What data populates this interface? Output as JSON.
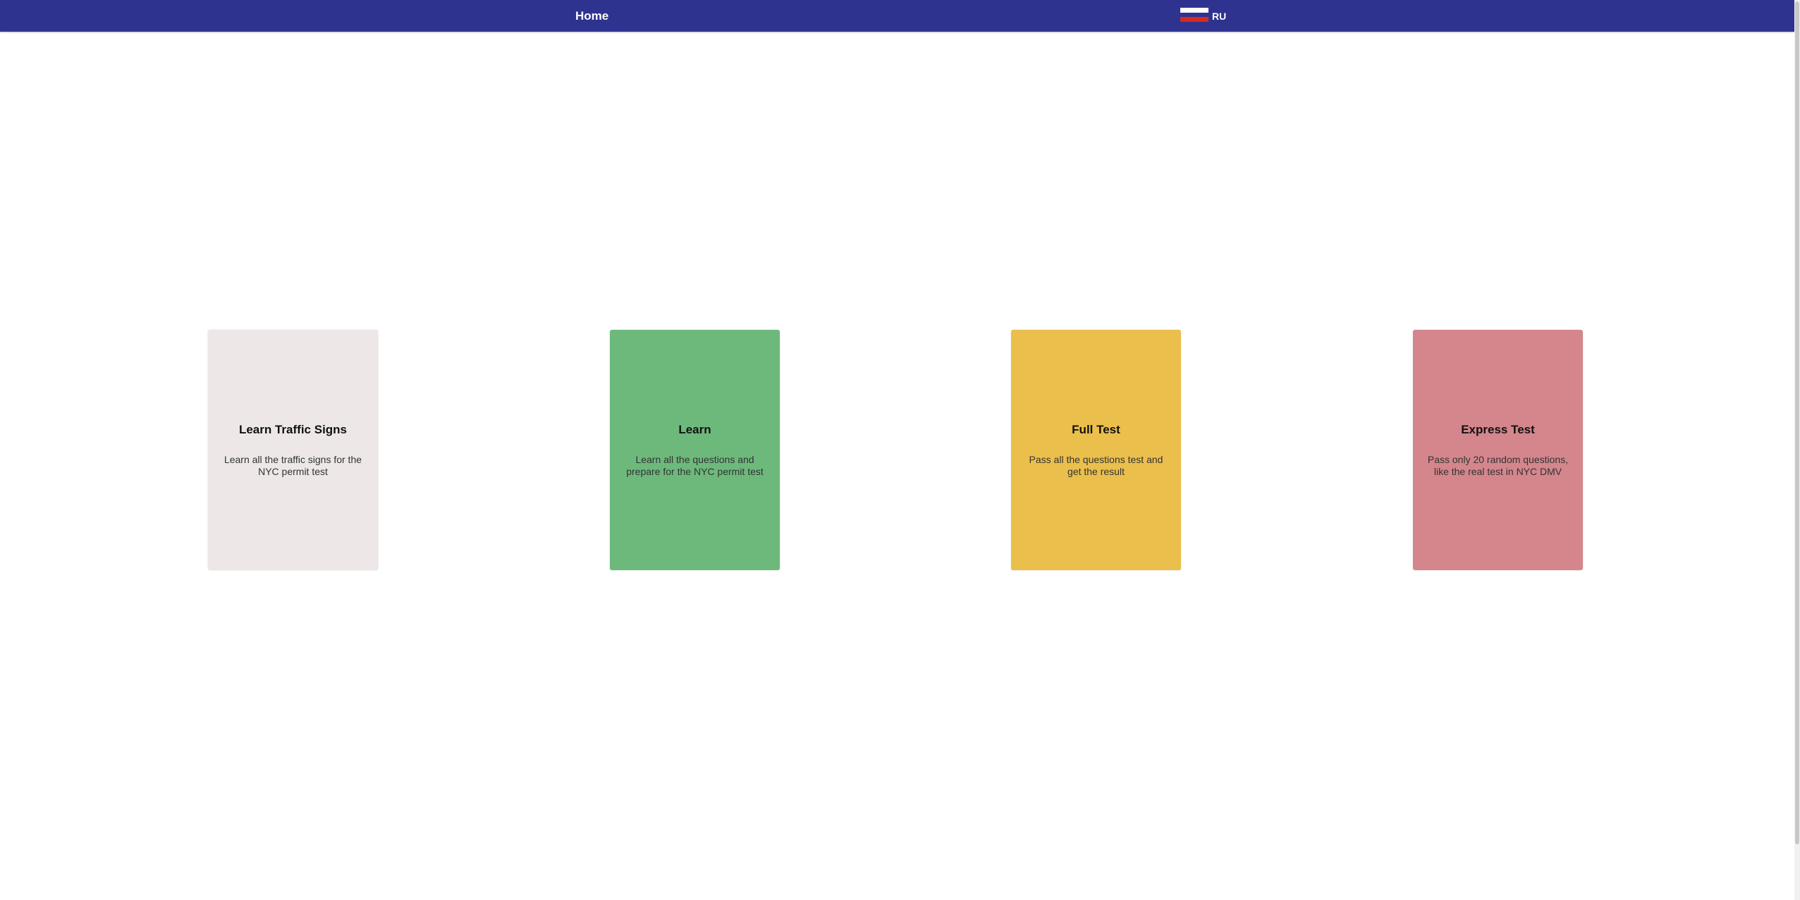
{
  "nav": {
    "home_label": "Home",
    "language_label": "RU",
    "flag_colors": [
      "#ffffff",
      "#2f3390",
      "#d52b1e"
    ]
  },
  "cards": [
    {
      "title": "Learn Traffic Signs",
      "description": "Learn all the traffic signs for the NYC permit test",
      "color": "#ede7e7"
    },
    {
      "title": "Learn",
      "description": "Learn all the questions and prepare for the NYC permit test",
      "color": "#6db97c"
    },
    {
      "title": "Full Test",
      "description": "Pass all the questions test and get the result",
      "color": "#ebbf4c"
    },
    {
      "title": "Express Test",
      "description": "Pass only 20 random questions, like the real test in NYC DMV",
      "color": "#d4868c"
    }
  ],
  "colors": {
    "navbar_bg": "#2f3390",
    "page_bg": "#ffffff"
  }
}
